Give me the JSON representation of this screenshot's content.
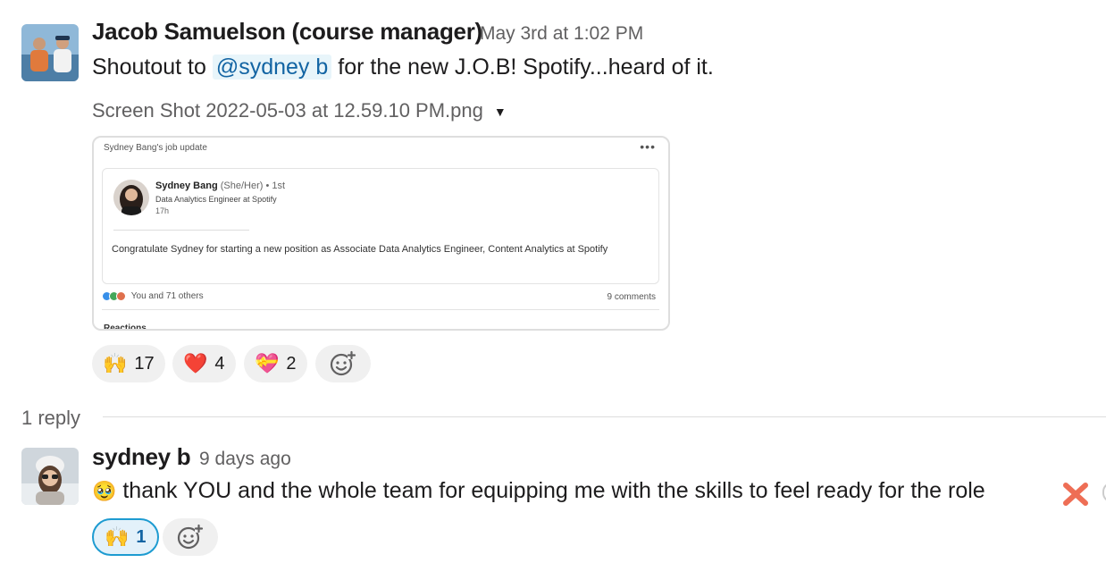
{
  "messages": [
    {
      "author": "Jacob Samuelson (course manager)",
      "timestamp": "May 3rd at 1:02 PM",
      "text_before": "Shoutout to",
      "mention": "@sydney b",
      "text_after": "for the new J.O.B! Spotify...heard of it.",
      "attachment": {
        "filename": "Screen Shot 2022-05-03 at 12.59.10 PM.png",
        "preview": {
          "header": "Sydney Bang's job update",
          "menu": "•••",
          "name": "Sydney Bang",
          "pronouns": "(She/Her) • 1st",
          "role": "Data Analytics Engineer at Spotify",
          "time": "17h",
          "body": "Congratulate Sydney for starting a new position as Associate Data Analytics Engineer, Content Analytics at Spotify",
          "reactions_text": "You and 71 others",
          "comments_text": "9 comments",
          "cut_off_label": "Reactions"
        }
      },
      "reactions": [
        {
          "emoji": "🙌",
          "icon": "raised-hands-icon",
          "count": "17"
        },
        {
          "emoji": "❤️",
          "icon": "red-heart-icon",
          "count": "4"
        },
        {
          "emoji": "💝",
          "icon": "heart-badge-icon",
          "count": "2"
        }
      ]
    },
    {
      "author": "sydney b",
      "timestamp": "9 days ago",
      "emoji_prefix": "🥹",
      "text": "thank YOU and the whole team for equipping me with the skills to feel ready for the role",
      "reactions": [
        {
          "emoji": "🙌",
          "icon": "raised-hands-icon",
          "count": "1",
          "reacted_by_me": true
        }
      ]
    }
  ],
  "thread": {
    "reply_count": "1 reply"
  },
  "colors": {
    "mention_bg": "#e8f5fa",
    "mention_text": "#1264a3",
    "my_reaction_border": "#1d9bd1",
    "timestamp": "#616061"
  }
}
